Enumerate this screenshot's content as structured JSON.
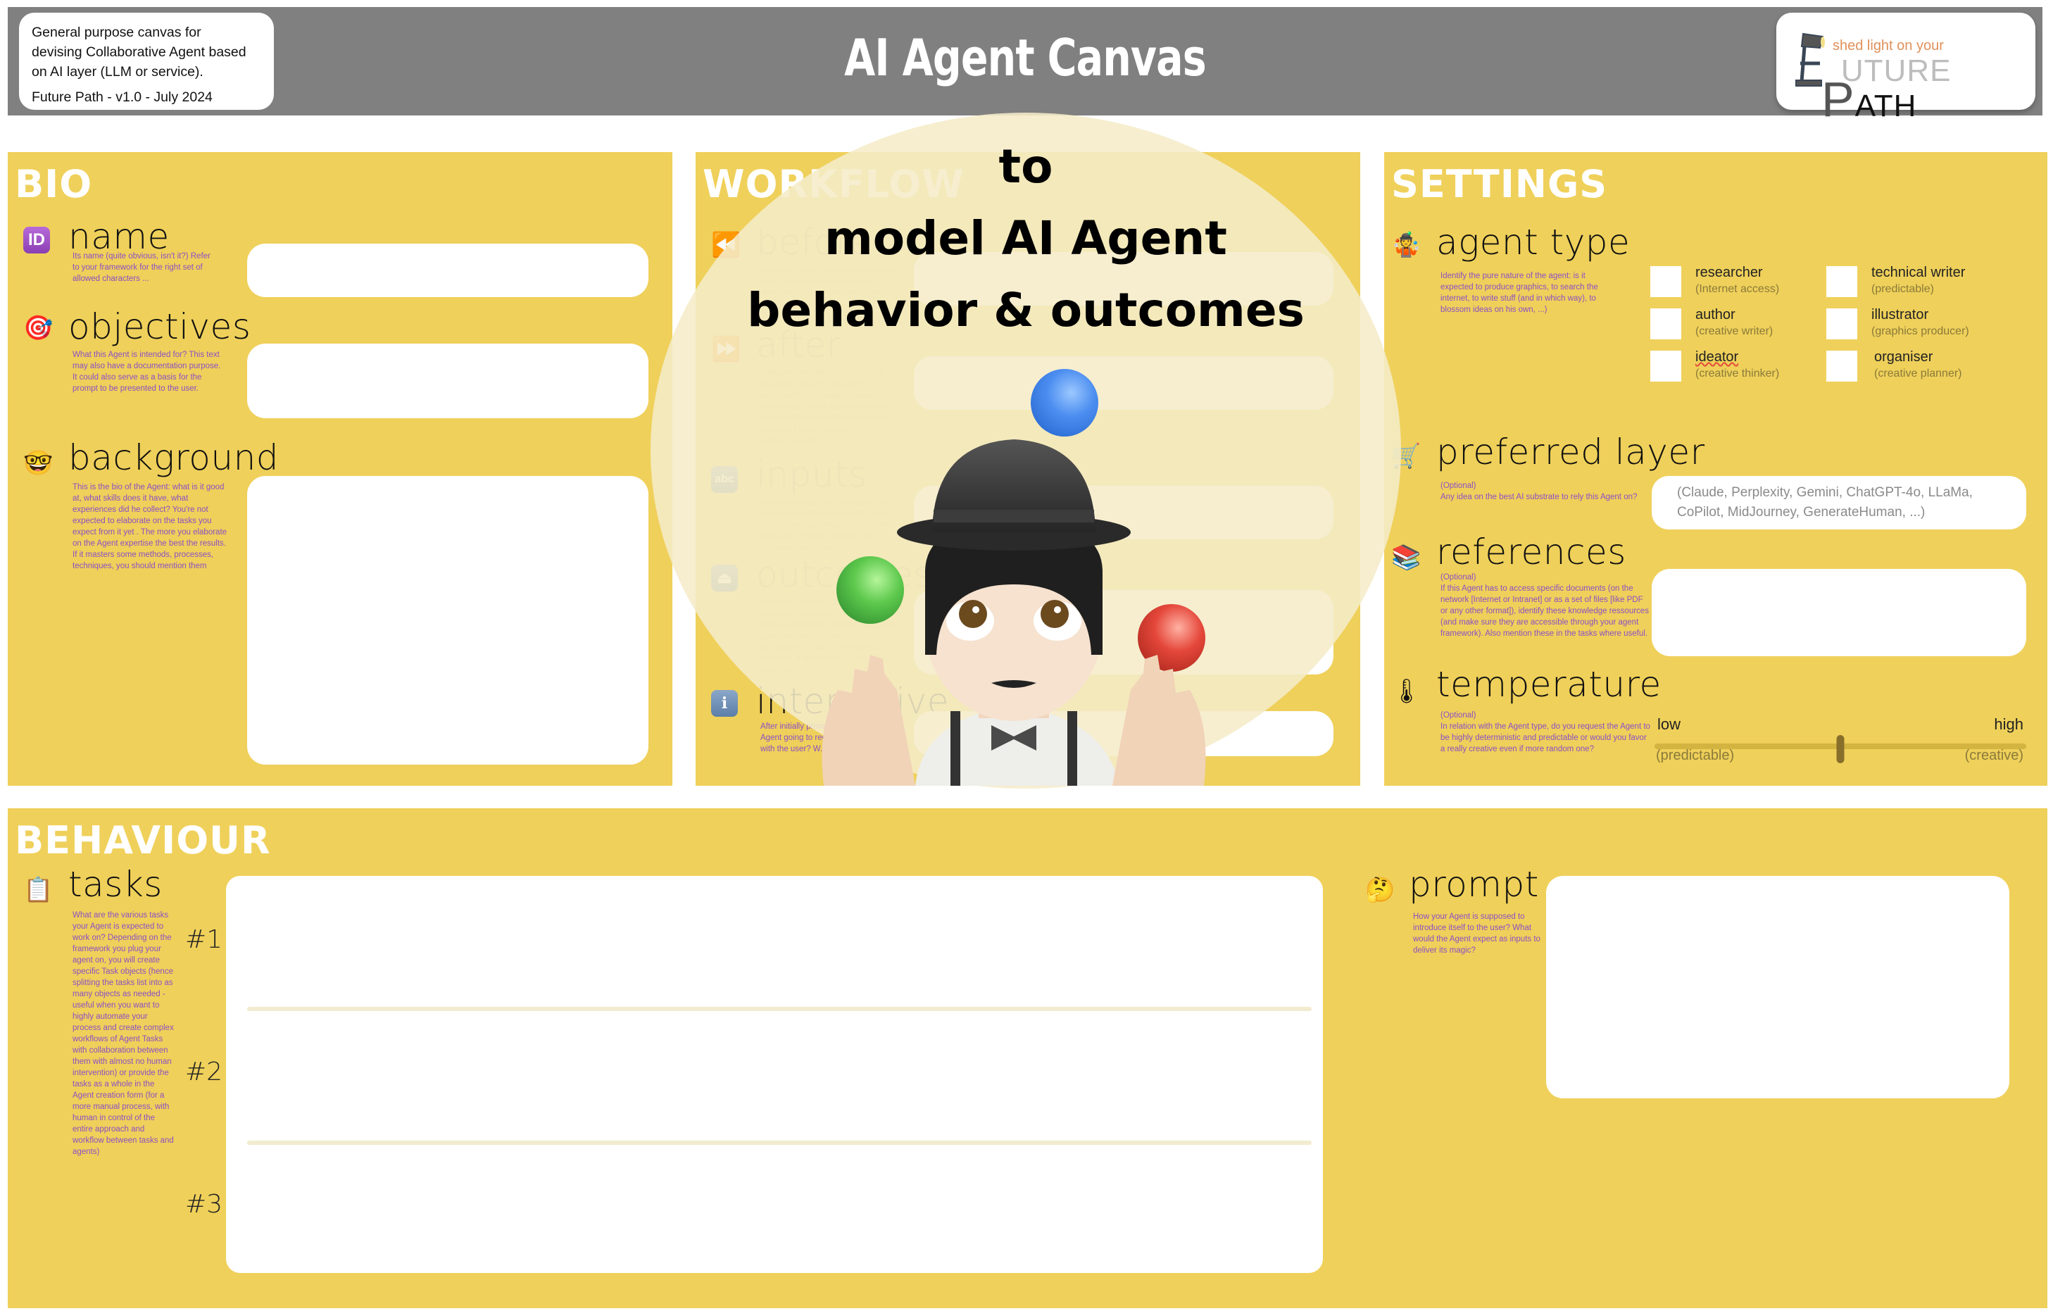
{
  "header": {
    "info_lines": [
      "General purpose canvas for",
      "devising Collaborative Agent based",
      "on AI layer (LLM or service)."
    ],
    "version": "Future Path - v1.0 - July 2024",
    "title": "AI Agent Canvas",
    "logo": {
      "tagline": "shed light on your",
      "word_part1": "F",
      "word_part2": "UTURE",
      "word_part3": "P",
      "word_part4": "ATH"
    }
  },
  "overlay": {
    "line1": "to",
    "line2": "model AI Agent",
    "line3": "behavior & outcomes",
    "image": "person-juggling-emoji"
  },
  "bio": {
    "title": "BIO",
    "fields": [
      {
        "icon": "id-icon",
        "icon_text": "ID",
        "label": "name",
        "help": "Its name (quite obvious, isn't it?) Refer to your framework for the right set of allowed characters ..."
      },
      {
        "icon": "dart-target-icon",
        "icon_text": "🎯",
        "label": "objectives",
        "help": "What this Agent is intended for? This text may also have a documentation purpose. It could also serve as a basis for the prompt to be presented to the user."
      },
      {
        "icon": "nerd-face-icon",
        "icon_text": "🤓",
        "label": "background",
        "help": "This is the bio of the Agent: what is it good at, what skills does it have, what experiences did he collect? You're not expected to elaborate on the tasks you expect from it yet . The more you elaborate on the Agent expertise the best the results. If it masters some methods, processes, techniques, you should mention them"
      }
    ]
  },
  "workflow": {
    "title": "WORKFLOW",
    "fields": [
      {
        "icon": "rewind-icon",
        "icon_text": "⏪",
        "label": "before",
        "help": "(Optional) Does this Agent is working best if it works after another one (or more) as the first? Does this agent ..."
      },
      {
        "icon": "fast-forward-icon",
        "icon_text": "⏩",
        "label": "after",
        "help": "(Optional) Any idea of which Agent would benefits from this ones outcomes? In a creative process, it is best practice to let a human review, modify and augment the outcomes of one agent before sending them to another agents."
      },
      {
        "icon": "abc-input-icon",
        "icon_text": "abc",
        "label": "inputs",
        "help": "What is expected by this Agent from the user to start working on its tasks? These expected inputs will likely land somewhere in the initial prompt submitted to the user."
      },
      {
        "icon": "eject-icon",
        "icon_text": "⏏",
        "label": "outcomes",
        "help": "What the user may get once this Agent completes its tasks: the nature of the contents (todo list, research outcomes, guidelines, novel ideas, ...) and its form (illustration, a table, a markdown contents, a simple text, ...) may be identified."
      },
      {
        "icon": "information-icon",
        "icon_text": "i",
        "label": "interactive",
        "help": "After initially prompting the user, is the Agent going to request a discussion with the user? W..."
      }
    ]
  },
  "settings": {
    "title": "SETTINGS",
    "agent_type": {
      "icon": "person-juggling-icon",
      "icon_text": "🤹",
      "label": "agent type",
      "help": "Identify the pure nature of the agent: is it expected to produce graphics, to search the internet, to write stuff (and in which way), to blossom ideas on his own, ...)",
      "options": [
        {
          "label": "researcher",
          "sub": "(Internet access)",
          "checked": false
        },
        {
          "label": "technical writer",
          "sub": "(predictable)",
          "checked": false
        },
        {
          "label": "author",
          "sub": "(creative writer)",
          "checked": false
        },
        {
          "label": "illustrator",
          "sub": "(graphics producer)",
          "checked": false
        },
        {
          "label": "ideator",
          "sub": "(creative thinker)",
          "checked": false
        },
        {
          "label": "organiser",
          "sub": "(creative planner)",
          "checked": false
        }
      ]
    },
    "preferred_layer": {
      "icon": "shopping-cart-icon",
      "icon_text": "🛒",
      "label": "preferred layer",
      "help_optional": "(Optional)",
      "help": "Any idea on the best AI substrate to rely this Agent on?",
      "placeholder_line1": "(Claude, Perplexity, Gemini, ChatGPT-4o, LLaMa,",
      "placeholder_line2": "CoPilot, MidJourney, GenerateHuman, ...)"
    },
    "references": {
      "icon": "books-icon",
      "icon_text": "📚",
      "label": "references",
      "help_optional": "(Optional)",
      "help": "If this Agent has to access specific documents (on the network [Internet or Intranet] or as a set of files [like PDF or any other format]), identify these knowledge ressources  (and make sure they are accessible through your agent framework). Also mention these in the tasks where useful."
    },
    "temperature": {
      "icon": "thermometer-icon",
      "icon_text": "🌡",
      "label": "temperature",
      "help_optional": "(Optional)",
      "help": "In relation with the Agent type, do you request the Agent to be highly deterministic and predictable or would you favor a really creative even if more random one?",
      "low_label": "low",
      "low_sub": "(predictable)",
      "high_label": "high",
      "high_sub": "(creative)",
      "value": 0.5
    }
  },
  "behaviour": {
    "title": "BEHAVIOUR",
    "tasks": {
      "icon": "clipboard-icon",
      "icon_text": "📋",
      "label": "tasks",
      "help": "What are the various tasks your Agent is expected to work on? Depending on the framework you plug your agent on, you will create specific Task objects (hence splitting the tasks list into as many objects as needed - useful when you want to highly automate your process and create complex workflows of Agent Tasks with collaboration between them with almost no human intervention) or provide the tasks as a whole in the Agent creation form (for a more manual process, with human in control of the entire approach and workflow between tasks and agents)",
      "numbers": [
        "#1",
        "#2",
        "#3"
      ]
    },
    "prompt": {
      "icon": "thinking-face-icon",
      "icon_text": "🤔",
      "label": "prompt",
      "help": "How your Agent is supposed to introduce itself to the user? What would the Agent expect as inputs to deliver its magic?"
    }
  },
  "colors": {
    "panel": "#efd05a",
    "header": "#808080",
    "help_text": "#8c4fc4",
    "overlay": "#f5ecc8"
  }
}
